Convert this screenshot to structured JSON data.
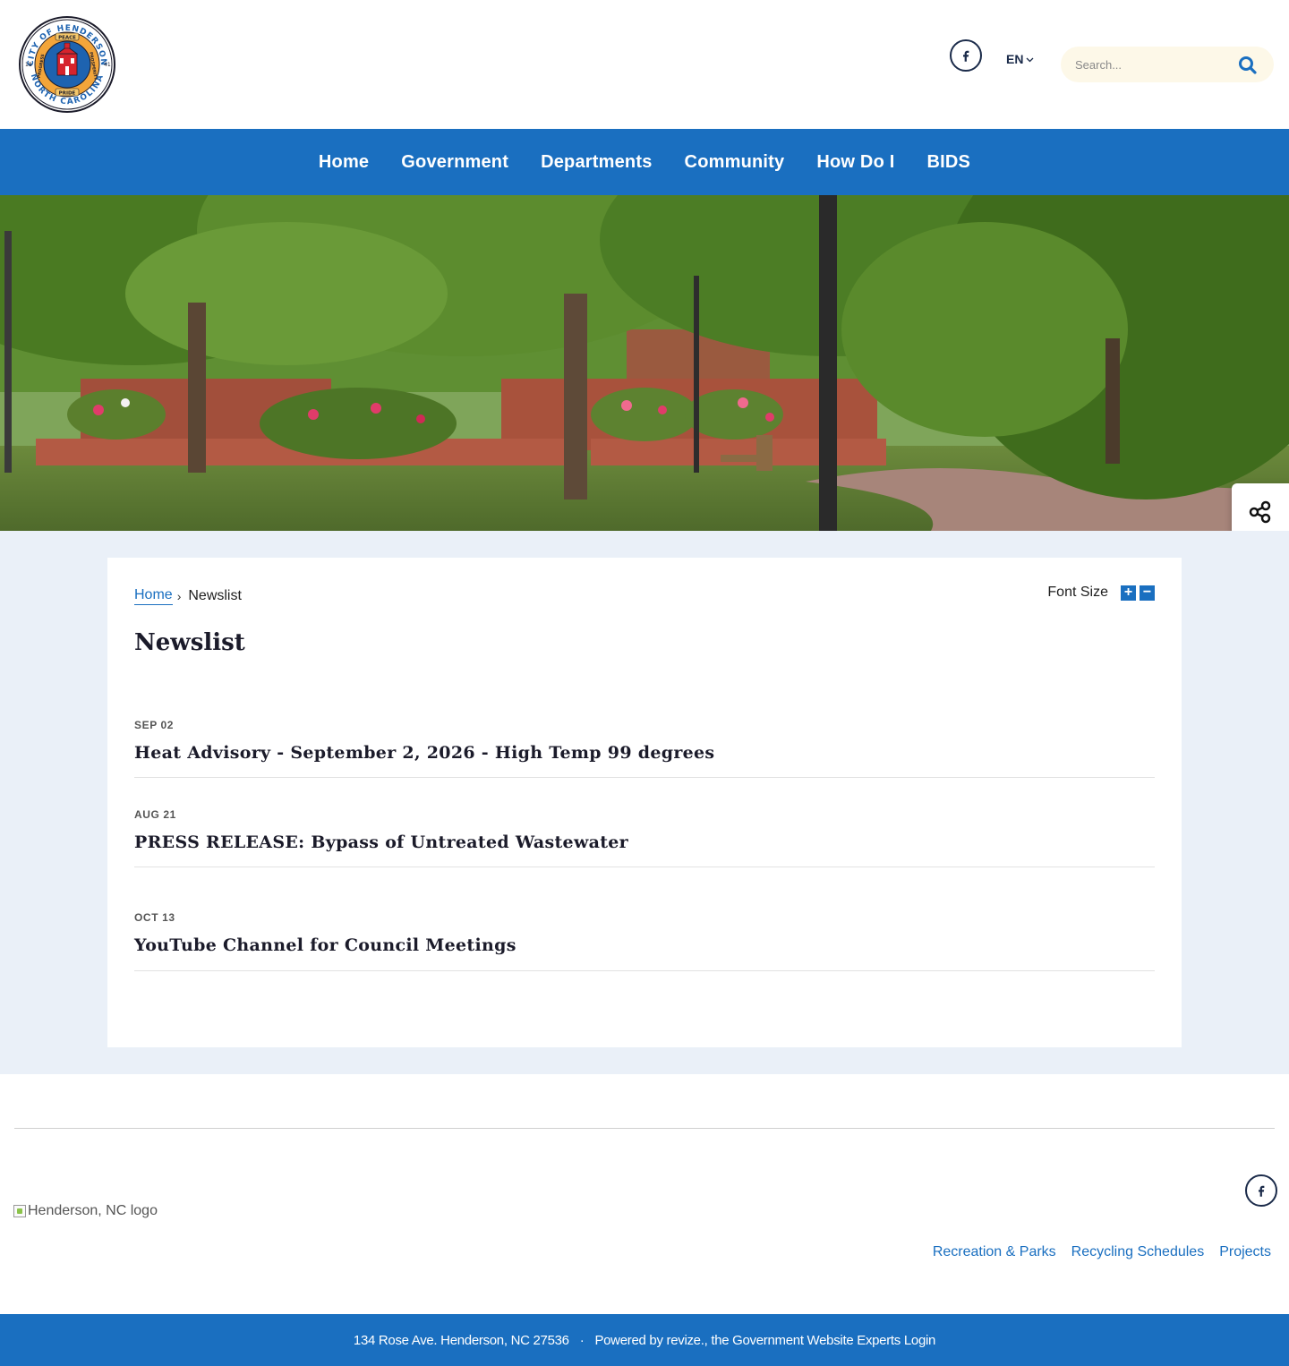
{
  "header": {
    "logo_lines": {
      "top": "CITY OF HENDERSON",
      "bottom": "NORTH CAROLINA",
      "banner_top": "PEACE",
      "banner_left": "PROGRESS",
      "banner_right": "PROSPERITY",
      "banner_bottom": "PRIDE",
      "year_left": "18",
      "year_right": "41"
    },
    "social_icon": "facebook-icon",
    "language": "EN",
    "search_placeholder": "Search..."
  },
  "nav": {
    "items": [
      "Home",
      "Government",
      "Departments",
      "Community",
      "How Do I",
      "BIDS"
    ]
  },
  "breadcrumb": {
    "home": "Home",
    "separator": "›",
    "current": "Newslist"
  },
  "font_size": {
    "label": "Font Size",
    "increase": "+",
    "decrease": "−"
  },
  "page_title": "Newslist",
  "news": [
    {
      "date": "SEP 02",
      "title": "Heat Advisory - September 2, 2026 - High Temp 99 degrees"
    },
    {
      "date": "AUG 21",
      "title": "PRESS RELEASE:  Bypass of Untreated Wastewater"
    },
    {
      "date": "OCT 13",
      "title": "YouTube Channel for Council Meetings"
    }
  ],
  "footer": {
    "logo_alt": "Henderson, NC logo",
    "links": [
      "Recreation & Parks",
      "Recycling Schedules",
      "Projects"
    ],
    "address": "134 Rose Ave. Henderson, NC 27536",
    "dot": "·",
    "powered": "Powered by revize., the Government Website Experts",
    "login": "Login"
  },
  "colors": {
    "brand_blue": "#1a6fc0",
    "main_bg": "#eaf0f8",
    "dark_text": "#1b1b2a"
  }
}
